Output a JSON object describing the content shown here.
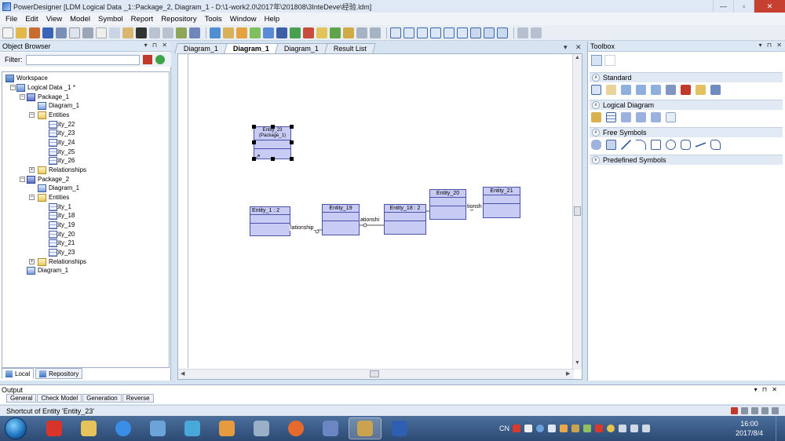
{
  "window": {
    "title": "PowerDesigner [LDM Logical Data _1::Package_2, Diagram_1 - D:\\1-work2.0\\2017年\\201808\\3InteDeve\\经验.ldm]",
    "minimize": "—",
    "maximize": "▫",
    "close": "✕"
  },
  "menu": [
    "File",
    "Edit",
    "View",
    "Model",
    "Symbol",
    "Report",
    "Repository",
    "Tools",
    "Window",
    "Help"
  ],
  "object_browser": {
    "title": "Object Browser",
    "pin_controls": "▾ ⊓ ✕",
    "filter_label": "Filter:",
    "filter_value": "",
    "tree": [
      {
        "label": "Workspace",
        "icon": "workspace-icon"
      },
      {
        "label": "Logical Data _1 *",
        "icon": "model-icon"
      },
      {
        "label": "Package_1",
        "icon": "package-icon"
      },
      {
        "label": "Diagram_1",
        "icon": "diagram-icon"
      },
      {
        "label": "Entities",
        "icon": "folder-icon"
      },
      {
        "label": "Entity_22",
        "icon": "entity-icon"
      },
      {
        "label": "Entity_23",
        "icon": "entity-icon"
      },
      {
        "label": "Entity_24",
        "icon": "entity-icon"
      },
      {
        "label": "Entity_25",
        "icon": "entity-icon"
      },
      {
        "label": "Entity_26",
        "icon": "entity-icon"
      },
      {
        "label": "Relationships",
        "icon": "folder-icon"
      },
      {
        "label": "Package_2",
        "icon": "package-icon"
      },
      {
        "label": "Diagram_1",
        "icon": "diagram-icon"
      },
      {
        "label": "Entities",
        "icon": "folder-icon"
      },
      {
        "label": "Entity_1",
        "icon": "entity-icon"
      },
      {
        "label": "Entity_18",
        "icon": "entity-icon"
      },
      {
        "label": "Entity_19",
        "icon": "entity-icon"
      },
      {
        "label": "Entity_20",
        "icon": "entity-icon"
      },
      {
        "label": "Entity_21",
        "icon": "entity-icon"
      },
      {
        "label": "Entity_23",
        "icon": "entity-icon"
      },
      {
        "label": "Relationships",
        "icon": "folder-icon"
      },
      {
        "label": "Diagram_1",
        "icon": "diagram-icon"
      }
    ],
    "tabs": [
      "Local",
      "Repository"
    ]
  },
  "doc_tabs": [
    "Diagram_1",
    "Diagram_1",
    "Diagram_1",
    "Result List"
  ],
  "doc_tab_controls": "▾ ✕",
  "diagram": {
    "entities": {
      "e23": {
        "name": "Entity_23",
        "sub": "(Package_1)"
      },
      "e1": {
        "name": "Entity_1 : 2"
      },
      "e19": {
        "name": "Entity_19"
      },
      "e18": {
        "name": "Entity_18 : 2"
      },
      "e20": {
        "name": "Entity_20"
      },
      "e21": {
        "name": "Entity_21"
      }
    },
    "relationship_labels": [
      "lationship_",
      "ationshi",
      "tionsh"
    ]
  },
  "toolbox": {
    "title": "Toolbox",
    "pin_controls": "▾ ⊓ ✕",
    "groups": [
      "Standard",
      "Logical Diagram",
      "Free Symbols",
      "Predefined Symbols"
    ]
  },
  "output": {
    "title": "Output",
    "tabs": [
      "General",
      "Check Model",
      "Generation",
      "Reverse"
    ],
    "pin_controls": "▾ ⊓ ✕"
  },
  "status": {
    "text": "Shortcut of Entity 'Entity_23'"
  },
  "taskbar": {
    "tray_lang": "CN",
    "time": "16:00",
    "date": "2017/8/4"
  },
  "colors": {
    "entity_fill": "#c8ccf5",
    "entity_border": "#4a52a8",
    "panel_header": "#dce7f4",
    "close_button": "#c7402f"
  }
}
